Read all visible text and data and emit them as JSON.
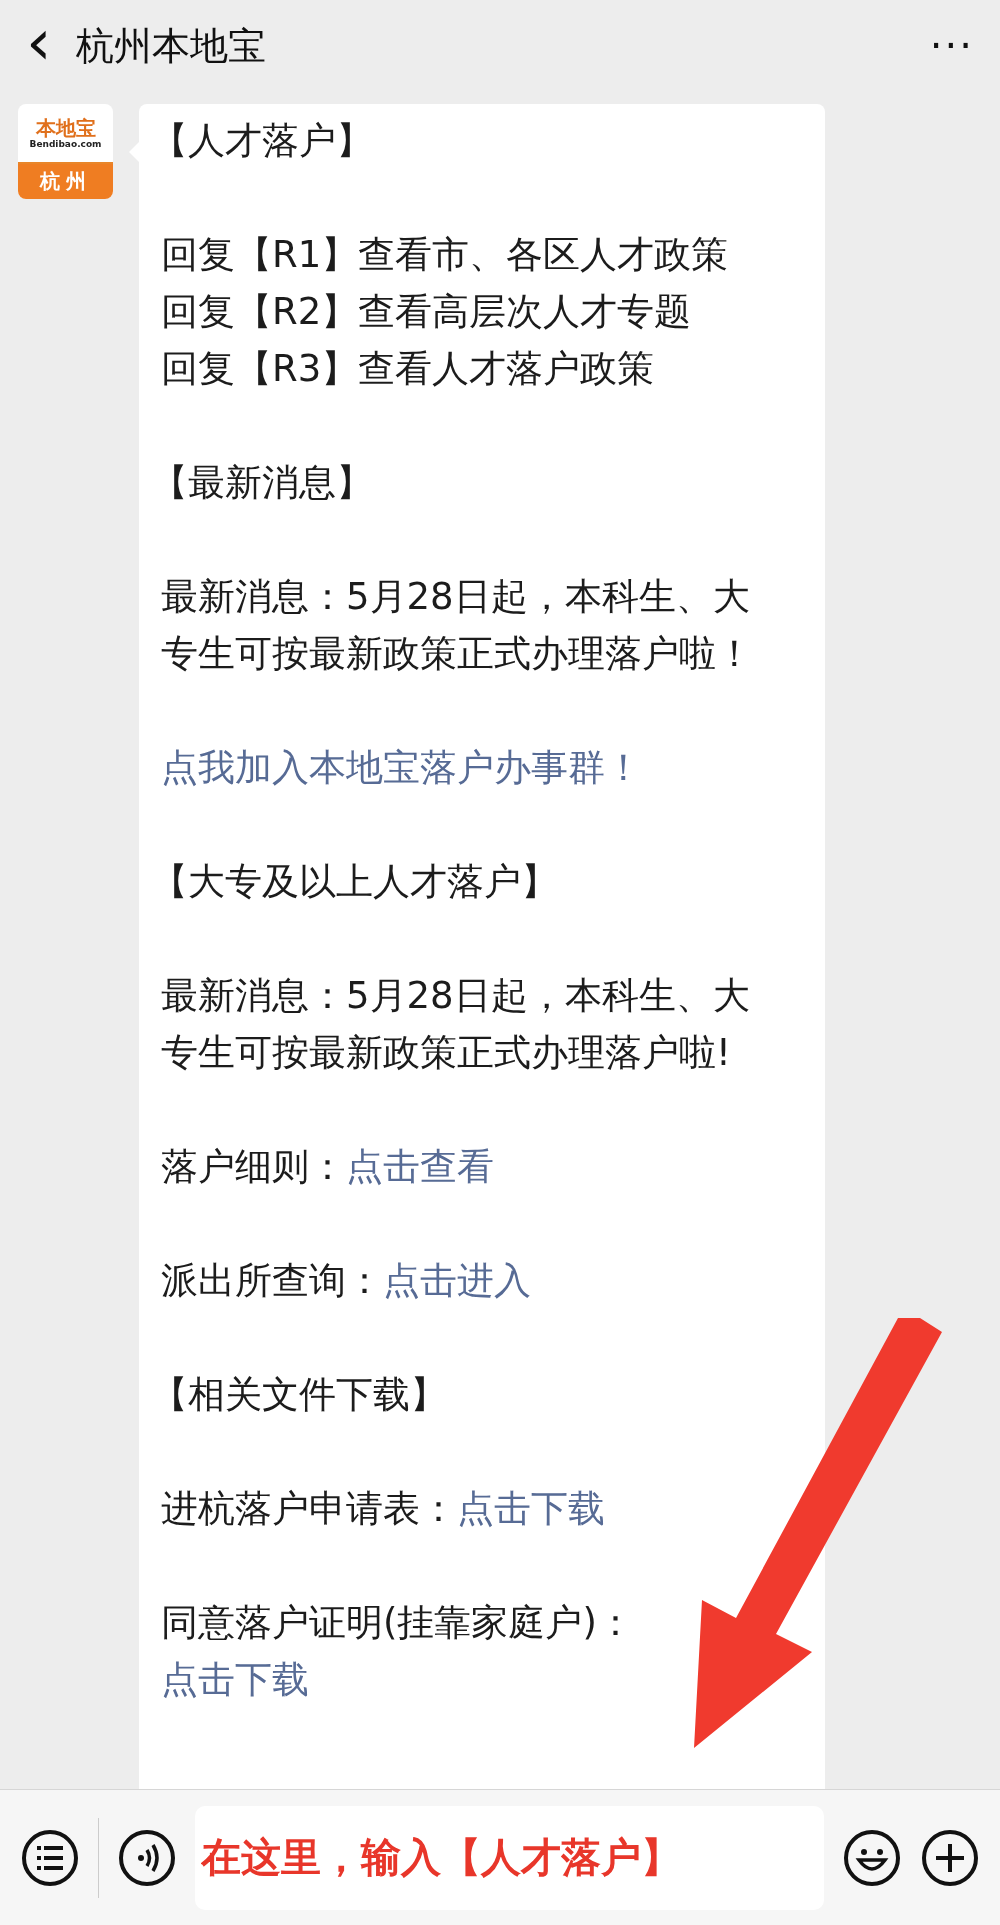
{
  "header": {
    "back": "‹",
    "title": "杭州本地宝",
    "more": "···"
  },
  "avatar": {
    "brand": "本地宝",
    "site": "Bendibao.com",
    "city": "杭州"
  },
  "message": {
    "paragraphs": [
      {
        "kind": "heading",
        "lines": [
          {
            "text": "【人才落户】"
          }
        ]
      },
      {
        "kind": "text",
        "lines": [
          {
            "text": "回复【R1】查看市、各区人才政策"
          },
          {
            "text": "回复【R2】查看高层次人才专题"
          },
          {
            "text": "回复【R3】查看人才落户政策"
          }
        ]
      },
      {
        "kind": "heading",
        "lines": [
          {
            "text": "【最新消息】"
          }
        ]
      },
      {
        "kind": "text",
        "lines": [
          {
            "text": "最新消息：5月28日起，本科生、大专生可按最新政策正式办理落户啦！"
          }
        ]
      },
      {
        "kind": "text",
        "lines": [
          {
            "link": "点我加入本地宝落户办事群！"
          }
        ]
      },
      {
        "kind": "heading",
        "lines": [
          {
            "text": "【大专及以上人才落户】"
          }
        ]
      },
      {
        "kind": "text",
        "lines": [
          {
            "text": "最新消息：5月28日起，本科生、大专生可按最新政策正式办理落户啦!"
          }
        ]
      },
      {
        "kind": "text",
        "lines": [
          {
            "text": "落户细则：",
            "link": "点击查看"
          }
        ]
      },
      {
        "kind": "text",
        "lines": [
          {
            "text": "派出所查询：",
            "link": "点击进入"
          }
        ]
      },
      {
        "kind": "heading",
        "lines": [
          {
            "text": "【相关文件下载】"
          }
        ]
      },
      {
        "kind": "text",
        "lines": [
          {
            "text": "进杭落户申请表：",
            "link": "点击下载"
          }
        ]
      },
      {
        "kind": "text",
        "lines": [
          {
            "text": "同意落户证明(挂靠家庭户)：",
            "link": "点击下载"
          }
        ]
      }
    ]
  },
  "input": {
    "value": "在这里，输入【人才落户】"
  }
}
